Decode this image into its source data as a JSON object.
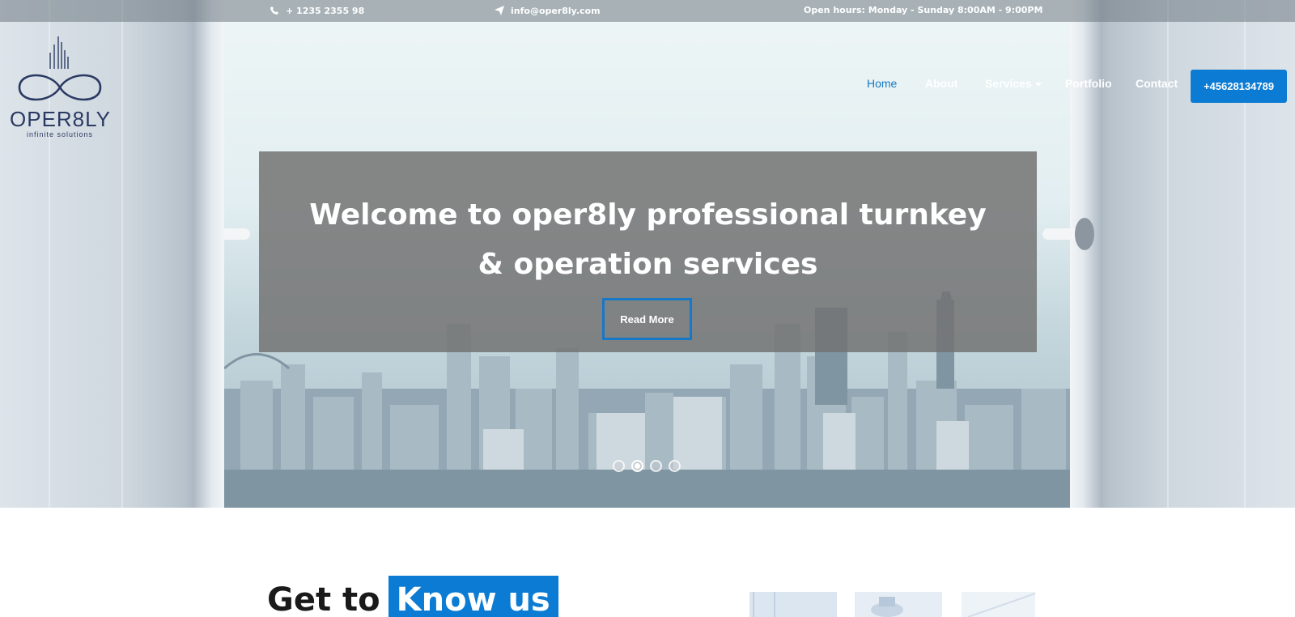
{
  "topbar": {
    "phone": "+ 1235 2355 98",
    "email": "info@oper8ly.com",
    "hours": "Open hours: Monday - Sunday 8:00AM - 9:00PM"
  },
  "logo": {
    "name": "OPER8LY",
    "tagline": "infinite solutions"
  },
  "nav": {
    "items": [
      {
        "label": "Home",
        "active": true
      },
      {
        "label": "About",
        "active": false
      },
      {
        "label": "Services",
        "active": false,
        "has_dropdown": true
      },
      {
        "label": "Portfolio",
        "active": false
      },
      {
        "label": "Contact",
        "active": false
      }
    ],
    "cta_phone": "+45628134789"
  },
  "hero": {
    "title_line1": "Welcome to oper8ly professional turnkey",
    "title_line2": "& operation services",
    "button": "Read More",
    "slides_total": 4,
    "slide_active": 2
  },
  "about": {
    "heading_plain": "Get to",
    "heading_highlight": "Know us"
  },
  "colors": {
    "accent": "#0b7bd3",
    "active_nav": "#1778c2",
    "caption_bg": "#737373"
  }
}
